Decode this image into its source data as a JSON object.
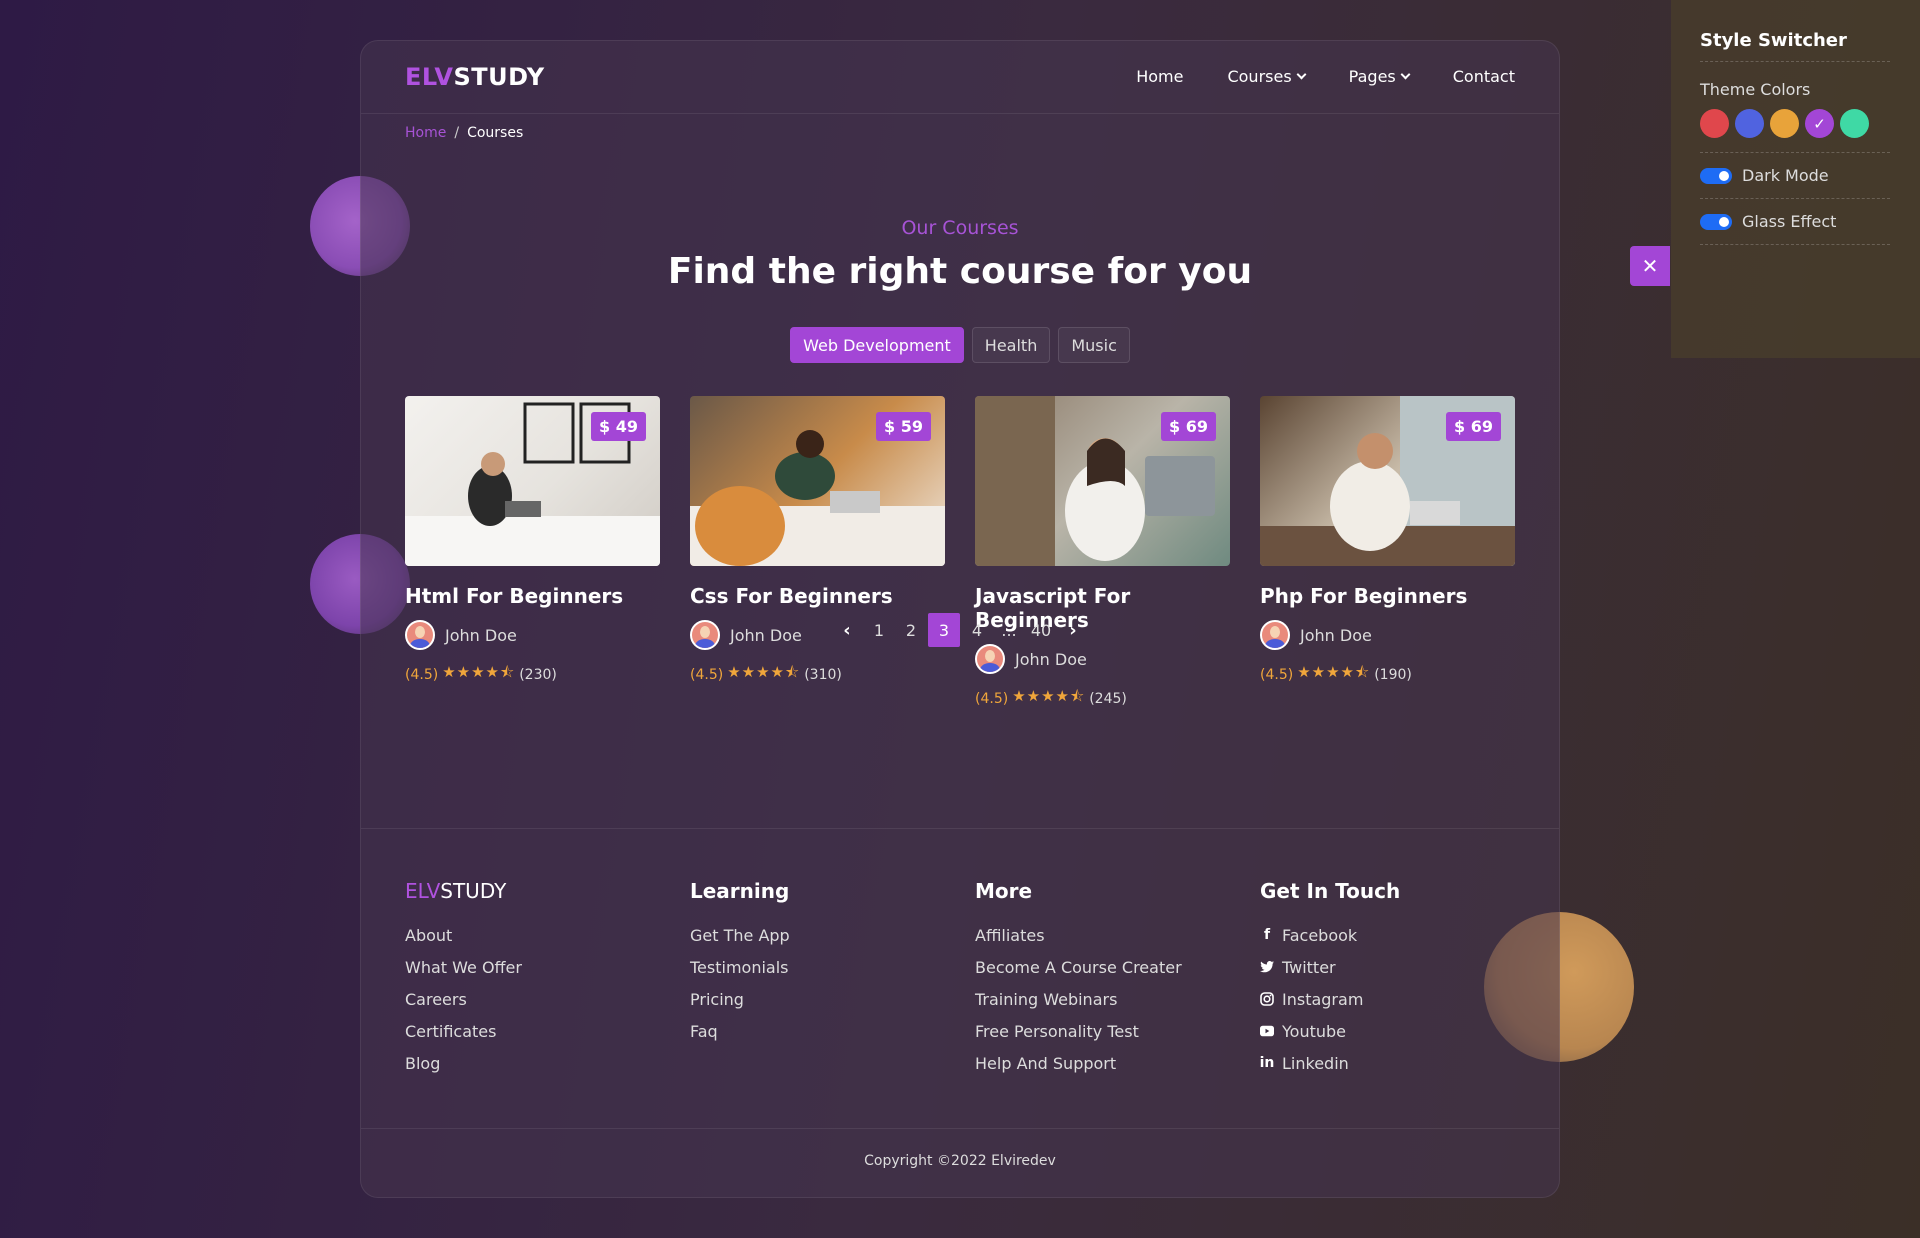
{
  "brand": {
    "prefix": "ELV",
    "suffix": "STUDY"
  },
  "nav": {
    "items": [
      {
        "label": "Home",
        "dropdown": false
      },
      {
        "label": "Courses",
        "dropdown": true
      },
      {
        "label": "Pages",
        "dropdown": true
      },
      {
        "label": "Contact",
        "dropdown": false
      }
    ]
  },
  "breadcrumb": {
    "home": "Home",
    "separator": "/",
    "current": "Courses"
  },
  "hero": {
    "eyebrow": "Our Courses",
    "title": "Find the right course for you"
  },
  "filters": [
    {
      "label": "Web Development",
      "active": true
    },
    {
      "label": "Health",
      "active": false
    },
    {
      "label": "Music",
      "active": false
    }
  ],
  "courses": [
    {
      "title": "Html For Beginners",
      "price": "$ 49",
      "author": "John Doe",
      "score": "(4.5)",
      "stars": "★★★★⯪",
      "count": "(230)"
    },
    {
      "title": "Css For Beginners",
      "price": "$ 59",
      "author": "John Doe",
      "score": "(4.5)",
      "stars": "★★★★⯪",
      "count": "(310)"
    },
    {
      "title": "Javascript For Beginners",
      "price": "$ 69",
      "author": "John Doe",
      "score": "(4.5)",
      "stars": "★★★★⯪",
      "count": "(245)"
    },
    {
      "title": "Php For Beginners",
      "price": "$ 69",
      "author": "John Doe",
      "score": "(4.5)",
      "stars": "★★★★⯪",
      "count": "(190)"
    }
  ],
  "pagination": {
    "prev": "‹",
    "next": "›",
    "pages": [
      "1",
      "2",
      "3",
      "4",
      "...",
      "40"
    ],
    "current": "3"
  },
  "footer": {
    "columns": [
      {
        "title": "",
        "links": [
          "About",
          "What We Offer",
          "Careers",
          "Certificates",
          "Blog"
        ]
      },
      {
        "title": "Learning",
        "links": [
          "Get The App",
          "Testimonials",
          "Pricing",
          "Faq"
        ]
      },
      {
        "title": "More",
        "links": [
          "Affiliates",
          "Become A Course Creater",
          "Training Webinars",
          "Free Personality Test",
          "Help And Support"
        ]
      },
      {
        "title": "Get In Touch",
        "links": [
          "Facebook",
          "Twitter",
          "Instagram",
          "Youtube",
          "Linkedin"
        ]
      }
    ],
    "social_icons": [
      "facebook-icon",
      "twitter-icon",
      "instagram-icon",
      "youtube-icon",
      "linkedin-icon"
    ],
    "copyright": "Copyright ©2022 Elviredev"
  },
  "style_switcher": {
    "title": "Style Switcher",
    "theme_label": "Theme Colors",
    "colors": [
      "#e0474c",
      "#5063e0",
      "#e8a33a",
      "#a346d6",
      "#3fd9a5"
    ],
    "selected_color": "#a346d6",
    "dark_mode_label": "Dark Mode",
    "dark_mode": true,
    "glass_label": "Glass Effect",
    "glass": true,
    "close_icon": "close-icon"
  },
  "colors": {
    "accent": "#a346d6",
    "rating": "#f0a63b",
    "toggle": "#1e6cf5"
  }
}
